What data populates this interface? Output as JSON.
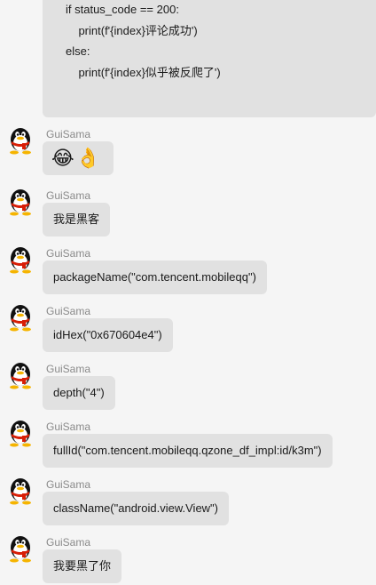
{
  "code_block": {
    "lines": [
      "if status_code == 200:",
      "    print(f'{index}评论成功')",
      "else:",
      "    print(f'{index}似乎被反爬了')"
    ]
  },
  "messages": [
    {
      "sender": "GuiSama",
      "type": "emoji",
      "emoji": [
        "😂",
        "👌"
      ]
    },
    {
      "sender": "GuiSama",
      "text": "我是黑客"
    },
    {
      "sender": "GuiSama",
      "text": "packageName(\"com.tencent.mobileqq\")"
    },
    {
      "sender": "GuiSama",
      "text": "idHex(\"0x670604e4\")"
    },
    {
      "sender": "GuiSama",
      "text": "depth(\"4\")"
    },
    {
      "sender": "GuiSama",
      "text": "fullId(\"com.tencent.mobileqq.qzone_df_impl:id/k3m\")"
    },
    {
      "sender": "GuiSama",
      "text": "className(\"android.view.View\")"
    },
    {
      "sender": "GuiSama",
      "text": "我要黑了你"
    }
  ],
  "colors": {
    "background": "#f5f5f5",
    "bubble": "#e1e1e1",
    "sender_name": "#8a8a8a",
    "text": "#1a1a1a"
  },
  "icons": {
    "avatar": "qq-penguin-icon"
  }
}
